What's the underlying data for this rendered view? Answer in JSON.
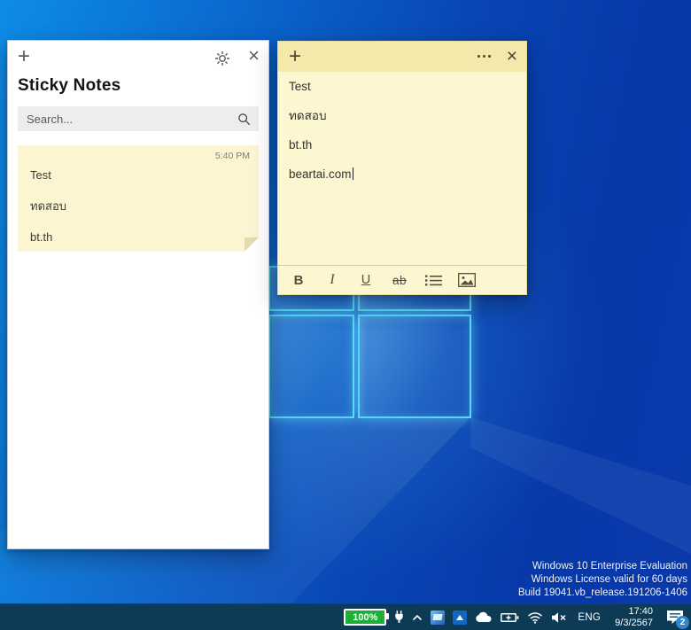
{
  "icons": {
    "new_note_glyph": "+",
    "close_glyph": "×",
    "settings_icon": "gear",
    "menu_icon": "ellipsis-dots",
    "search_icon": "magnifier",
    "cloud_icon": "cloud",
    "plug_icon": "power-plug",
    "chevron_icon": "chevron-up",
    "wifi_icon": "wifi-signal",
    "volume_icon": "speaker-muted",
    "power_status_icon": "battery-plugged",
    "action_center_icon": "notification-bubble"
  },
  "list_window": {
    "title": "Sticky Notes",
    "search_placeholder": "Search...",
    "note_card": {
      "timestamp": "5:40 PM",
      "lines": [
        "Test",
        "ทดสอบ",
        "bt.th"
      ]
    }
  },
  "note_window": {
    "lines": [
      "Test",
      "ทดสอบ",
      "bt.th",
      "beartai.com"
    ],
    "toolbar": {
      "bold": "B",
      "italic": "I",
      "underline": "U",
      "strikethrough": "ab"
    }
  },
  "taskbar": {
    "battery_percent": "100%",
    "language": "ENG",
    "time": "17:40",
    "date": "9/3/2567",
    "notification_count": "2"
  },
  "watermark": {
    "line1": "Windows 10 Enterprise Evaluation",
    "line2": "Windows License valid for 60 days",
    "line3": "Build 19041.vb_release.191206-1406"
  },
  "colors": {
    "note_body": "#fdf7d1",
    "note_header": "#f4e9ab",
    "note_card": "#fcf5d2",
    "battery_green": "#1fae38",
    "taskbar_bg": "#0d3a55",
    "badge_blue": "#2f86d2",
    "wallpaper_light": "#0e8ce6",
    "wallpaper_dark": "#0739a9",
    "logo_cyan": "#55d8f7"
  }
}
